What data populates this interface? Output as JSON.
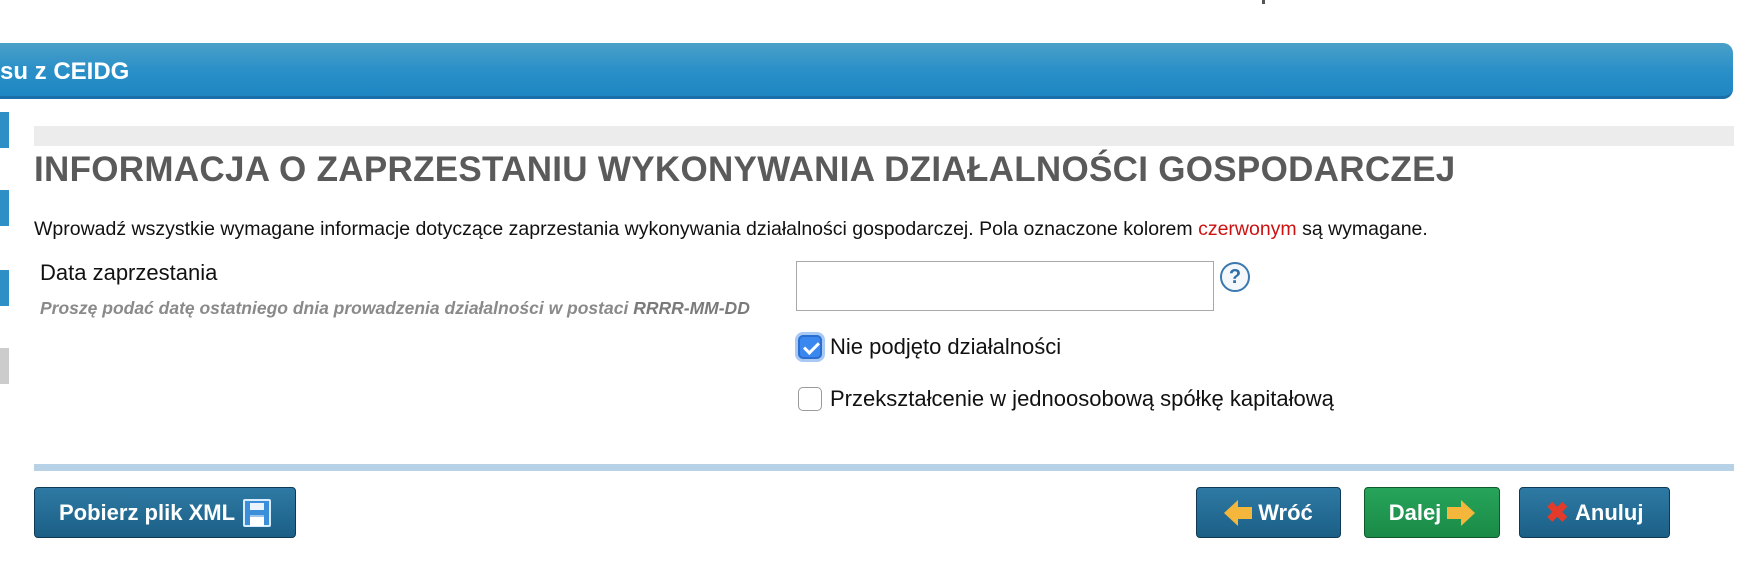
{
  "header": {
    "title": "su z CEIDG"
  },
  "page": {
    "title": "INFORMACJA O ZAPRZESTANIU WYKONYWANIA DZIAŁALNOŚCI GOSPODARCZEJ",
    "intro_before": "Wprowadź wszystkie wymagane informacje dotyczące zaprzestania wykonywania działalności gospodarczej. Pola oznaczone kolorem ",
    "intro_red": "czerwonym",
    "intro_after": " są wymagane."
  },
  "field": {
    "label": "Data zaprzestania",
    "hint": "Proszę podać datę ostatniego dnia prowadzenia działalności w postaci ",
    "hint_format": "RRRR-MM-DD",
    "value": "",
    "help": "?"
  },
  "checkboxes": [
    {
      "label": "Nie podjęto działalności",
      "checked": true
    },
    {
      "label": "Przekształcenie w jednoosobową spółkę kapitałową",
      "checked": false
    }
  ],
  "buttons": {
    "xml": "Pobierz plik XML",
    "back": "Wróć",
    "next": "Dalej",
    "cancel": "Anuluj"
  },
  "icons": {
    "help": "help-icon",
    "xml": "floppy-disk-icon",
    "back": "arrow-left-icon",
    "next": "arrow-right-icon",
    "cancel": "close-icon"
  },
  "colors": {
    "header": "#2b90c8",
    "required": "#cc1111",
    "button_blue": "#1b5f86",
    "button_green": "#1a8a47"
  }
}
